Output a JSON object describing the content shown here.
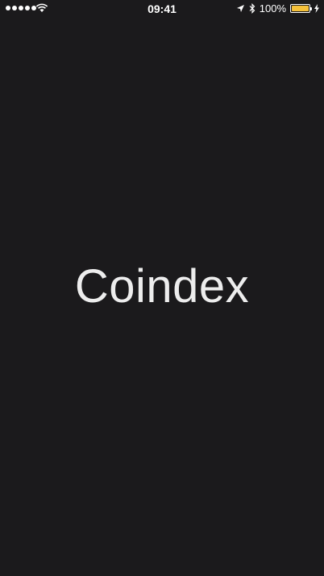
{
  "status_bar": {
    "time": "09:41",
    "battery_text": "100%",
    "battery_level": 1.0,
    "signal_bars": 5,
    "icons": [
      "signal-dots-icon",
      "wifi-icon",
      "location-arrow-icon",
      "bluetooth-icon",
      "battery-icon",
      "charging-bolt-icon"
    ]
  },
  "splash": {
    "app_name": "Coindex"
  },
  "colors": {
    "background": "#1b1a1c",
    "title_text": "#ededed",
    "battery_fill": "#f5c13a"
  }
}
